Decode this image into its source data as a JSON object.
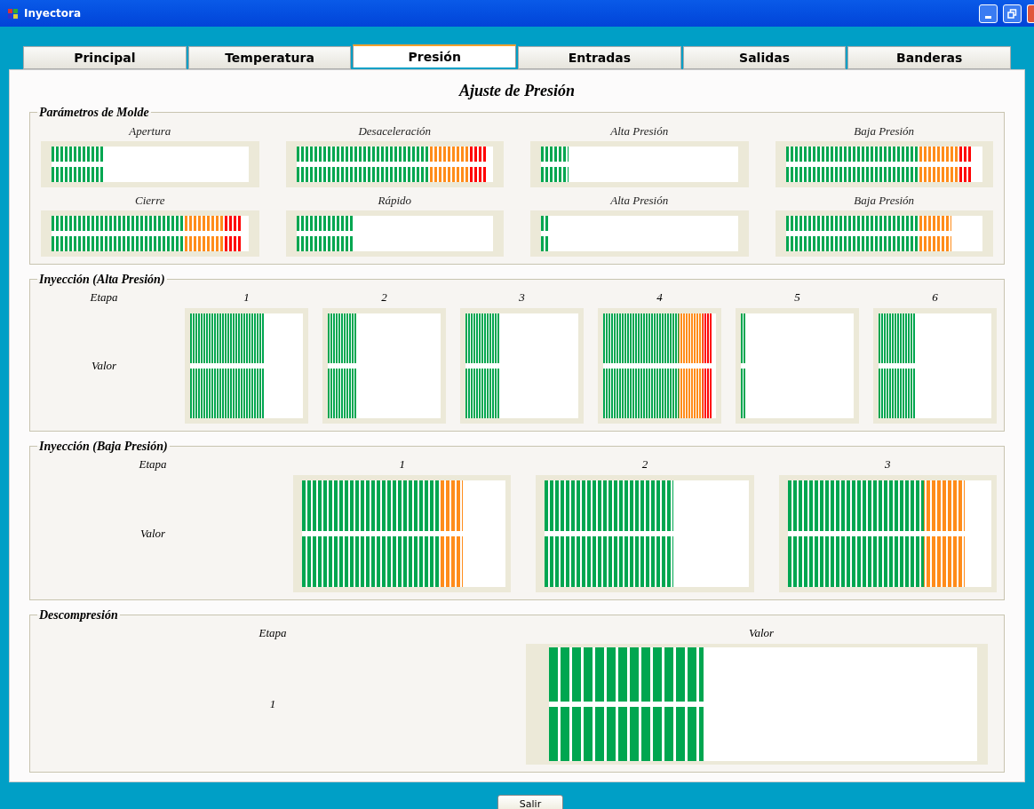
{
  "window": {
    "title": "Inyectora"
  },
  "tabs": [
    {
      "label": "Principal",
      "selected": false
    },
    {
      "label": "Temperatura",
      "selected": false
    },
    {
      "label": "Presión",
      "selected": true
    },
    {
      "label": "Entradas",
      "selected": false
    },
    {
      "label": "Salidas",
      "selected": false
    },
    {
      "label": "Banderas",
      "selected": false
    }
  ],
  "heading": "Ajuste de Presión",
  "molde": {
    "title": "Parámetros de Molde",
    "meters": [
      {
        "label": "Apertura",
        "level": 0.26
      },
      {
        "label": "Desaceleración",
        "level": 0.97
      },
      {
        "label": "Alta Presión",
        "level": 0.14
      },
      {
        "label": "Baja Presión",
        "level": 0.94
      },
      {
        "label": "Cierre",
        "level": 0.97
      },
      {
        "label": "Rápido",
        "level": 0.29
      },
      {
        "label": "Alta Presión",
        "level": 0.04
      },
      {
        "label": "Baja Presión",
        "level": 0.84
      }
    ]
  },
  "alta": {
    "title": "Inyección (Alta Presión)",
    "stage_label": "Etapa",
    "value_label": "Valor",
    "stages": [
      {
        "label": "1",
        "level": 0.65
      },
      {
        "label": "2",
        "level": 0.26
      },
      {
        "label": "3",
        "level": 0.31
      },
      {
        "label": "4",
        "level": 0.97
      },
      {
        "label": "5",
        "level": 0.04
      },
      {
        "label": "6",
        "level": 0.33
      }
    ]
  },
  "baja": {
    "title": "Inyección (Baja Presión)",
    "stage_label": "Etapa",
    "value_label": "Valor",
    "stages": [
      {
        "label": "1",
        "level": 0.79
      },
      {
        "label": "2",
        "level": 0.63
      },
      {
        "label": "3",
        "level": 0.87
      }
    ]
  },
  "descompresion": {
    "title": "Descompresión",
    "stage_label": "Etapa",
    "value_label": "Valor",
    "stages": [
      {
        "label": "1",
        "level": 0.36
      }
    ]
  },
  "buttons": [
    "Salir"
  ]
}
